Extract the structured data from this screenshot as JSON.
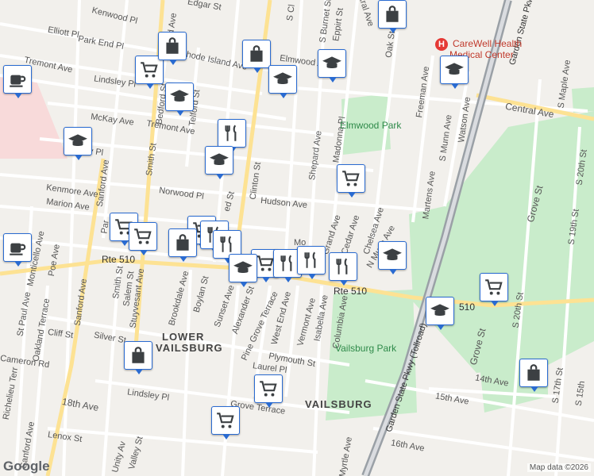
{
  "map": {
    "labels": {
      "kenwood_pl": "Kenwood Pl",
      "elliott_pl": "Elliott Pl",
      "park_end_pl": "Park End Pl",
      "tremont_ave_w": "Tremont Ave",
      "lindsley_pl_n": "Lindsley Pl",
      "rhode_island_ave": "Rhode Island Ave",
      "mckay_ave": "McKay Ave",
      "tremont_ave": "Tremont Ave",
      "finlay_pl": "Finlay Pl",
      "kenmore_ave": "Kenmore Ave",
      "marion_ave": "Marion Ave",
      "norwood_pl": "Norwood Pl",
      "hudson_ave": "Hudson Ave",
      "sanford_ave_1": "Sanford Ave",
      "sanford_ave_2": "Sanford Ave",
      "sanford_ave_3": "Sanford Ave",
      "sanford_ave_4": "Sanford Ave",
      "stuyvesant_ave": "Stuyvesant Ave",
      "bedford_st": "Bedford St",
      "telford_st": "Telford St",
      "smith_st_n": "Smith St",
      "smith_st_s": "Smith St",
      "salem_st": "Salem St",
      "parker": "Par",
      "monticello": "Monticello Ave",
      "poe_ave": "Poe Ave",
      "st_paul_ave": "St Paul Ave",
      "oakland_terrace": "Oakland Terrace",
      "richelieu": "Richelieu Terr",
      "cameron_rd": "Cameron Rd",
      "cliff_st": "Cliff St",
      "silver_st": "Silver St",
      "elmwood_ave": "Elmwood Ave",
      "clinton_st": "Clinton St",
      "s_clinton": "S Cl",
      "s_burnet": "S Burnet St",
      "eppirt_st": "Eppirt St",
      "central_ave_n": "Central Ave",
      "shepard_ave": "Shepard Ave",
      "madonna_pl": "Madonna Pl",
      "oak_st": "Oak St",
      "freeman_ave": "Freeman Ave",
      "s_munn_ave": "S Munn Ave",
      "watson_ave": "Watson Ave",
      "central_ave_e": "Central Ave",
      "s_maple_ave": "S Maple Ave",
      "martens_ave": "Martens Ave",
      "grand_ave": "Grand Ave",
      "cedar_ave": "Cedar Ave",
      "chelsea_ave": "Chelsea Ave",
      "n_munn_ave": "N Munn Ave",
      "grove_st_e": "Grove St",
      "grove_st_s": "Grove St",
      "s_20th_st_n": "S 20th St",
      "s_19th_st": "S 19th St",
      "s_20th_st_s": "S 20th St",
      "s_17th_st": "S 17th St",
      "s_15th": "S 15th",
      "fourteenth_ave": "14th Ave",
      "fifteenth_ave": "15th Ave",
      "sixteenth_ave": "16th Ave",
      "eighteenth_ave": "18th Ave",
      "rte510_w": "Rte 510",
      "rte510_c": "Rte 510",
      "rte510_e": "510",
      "boylan_st": "Boylan St",
      "brookdale_ave": "Brookdale Ave",
      "sunset_ave": "Sunset Ave",
      "alexander_st": "Alexander St",
      "pine_grove_terrace": "Pine Grove Terrace",
      "west_end_ave": "West End Ave",
      "vermont_ave": "Vermont Ave",
      "isabella_ave": "Isabella Ave",
      "columbia_ave": "Columbia Ave",
      "plymouth_st": "Plymouth St",
      "laurel_pl": "Laurel Pl",
      "lindsley_pl_s": "Lindsley Pl",
      "grove_terrace": "Grove Terrace",
      "lenox_st": "Lenox St",
      "valley_st": "Valley St",
      "unity_ave": "Unity Av",
      "myrtle_ave": "Myrtle Ave",
      "gsp": "Garden State Pkwy (Tollroad)",
      "gsp_n": "Garden State Pkwy",
      "lower_vailsburg_1": "LOWER",
      "lower_vailsburg_2": "VAILSBURG",
      "vailsburg": "VAILSBURG",
      "elmwood_park": "Elmwood Park",
      "vailsburg_park": "Vailsburg Park",
      "carewell_1": "CareWell Health",
      "carewell_2": "Medical Center",
      "mo": "Mo",
      "ed_st": "ed St",
      "gar_st": "Edgar St",
      "b_st": "B"
    },
    "pins": [
      {
        "icon": "grocery-icon"
      },
      {
        "icon": "shopping-bag-icon"
      },
      {
        "icon": "shopping-bag-icon"
      },
      {
        "icon": "school-icon"
      },
      {
        "icon": "school-icon"
      },
      {
        "icon": "school-icon"
      },
      {
        "icon": "school-icon"
      },
      {
        "icon": "cafe-icon"
      },
      {
        "icon": "cafe-icon"
      },
      {
        "icon": "school-icon"
      },
      {
        "icon": "restaurant-icon"
      },
      {
        "icon": "school-icon"
      },
      {
        "icon": "grocery-icon"
      },
      {
        "icon": "grocery-icon"
      },
      {
        "icon": "grocery-icon"
      },
      {
        "icon": "grocery-icon"
      },
      {
        "icon": "restaurant-icon"
      },
      {
        "icon": "shopping-bag-icon"
      },
      {
        "icon": "restaurant-icon"
      },
      {
        "icon": "grocery-icon"
      },
      {
        "icon": "restaurant-icon"
      },
      {
        "icon": "restaurant-icon"
      },
      {
        "icon": "school-icon"
      },
      {
        "icon": "restaurant-icon"
      },
      {
        "icon": "school-icon"
      },
      {
        "icon": "grocery-icon"
      },
      {
        "icon": "school-icon"
      },
      {
        "icon": "shopping-bag-icon"
      },
      {
        "icon": "grocery-icon"
      },
      {
        "icon": "grocery-icon"
      },
      {
        "icon": "shopping-bag-icon"
      },
      {
        "icon": "shopping-bag-icon"
      }
    ],
    "hospital_icon": "hospital-icon",
    "logo": "Google",
    "attribution": "Map data ©2026",
    "colors": {
      "land": "#f2f0ec",
      "road": "#ffffff",
      "arterial": "#fde293",
      "highway": "#9aa0a6",
      "park": "#c9eccb",
      "hospital_area": "#f8dada",
      "pin_border": "#2a6bd1",
      "pin_icon": "#3c4043"
    }
  }
}
